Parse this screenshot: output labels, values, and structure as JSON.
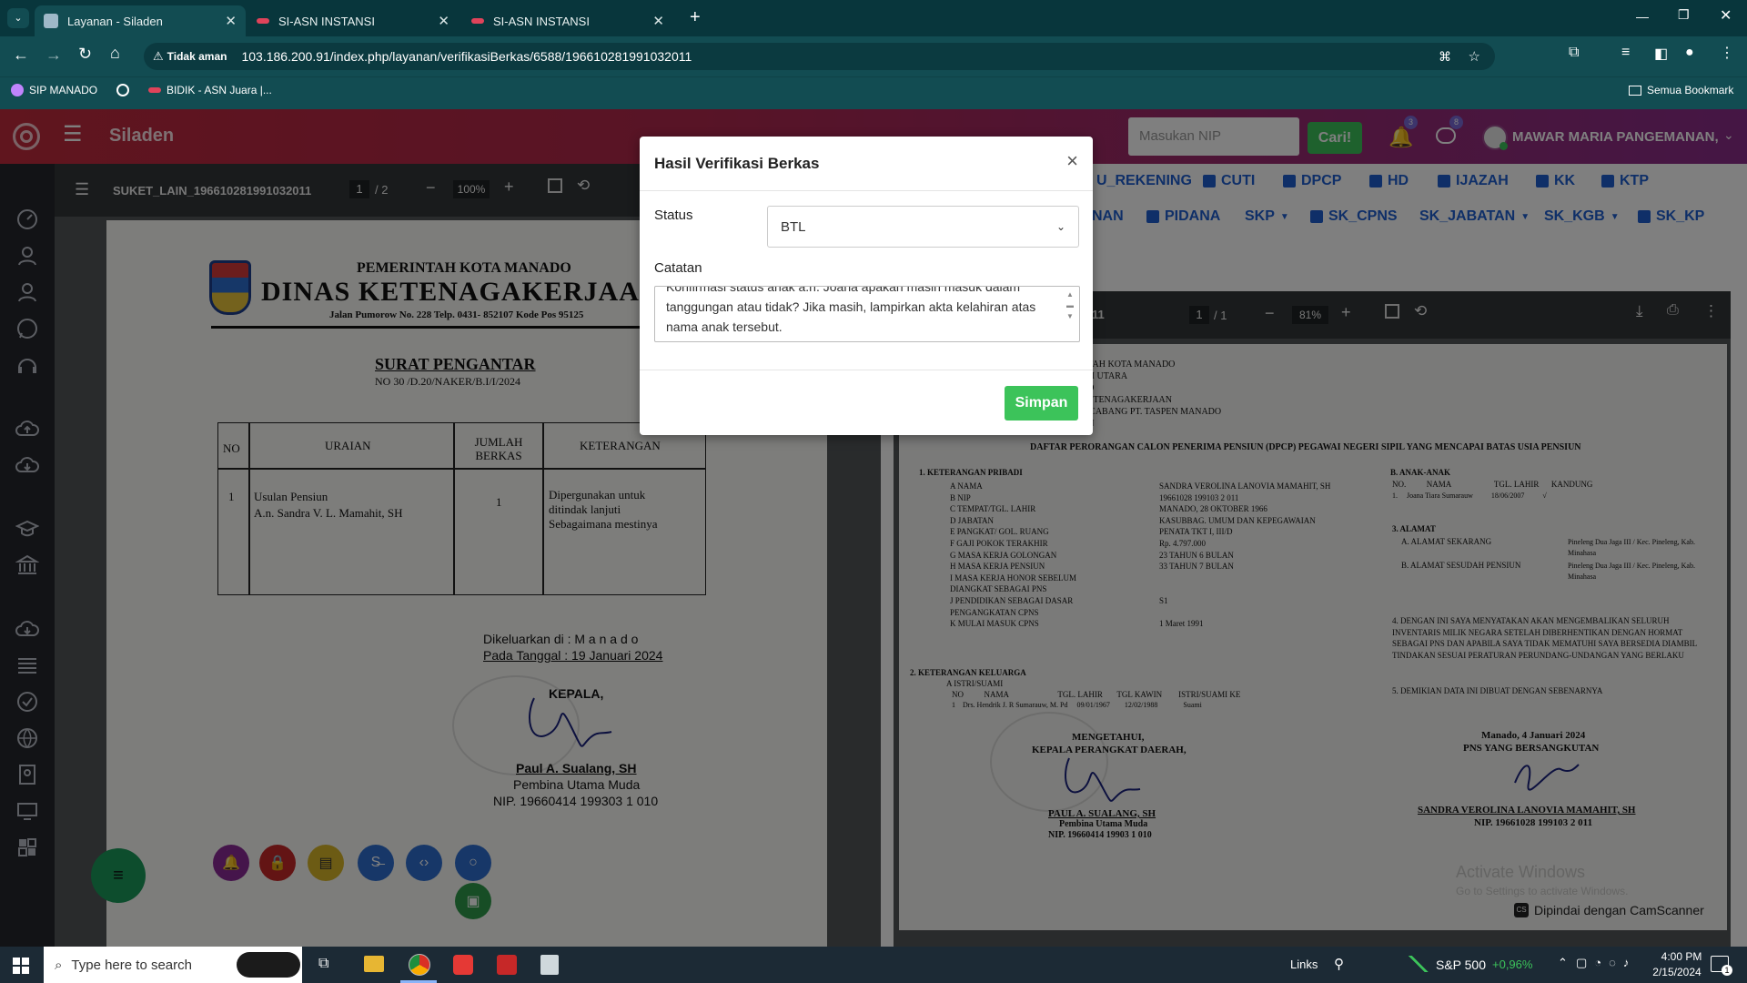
{
  "browser": {
    "tabs": [
      {
        "title": "Layanan - Siladen",
        "active": true
      },
      {
        "title": "SI-ASN INSTANSI",
        "active": false
      },
      {
        "title": "SI-ASN INSTANSI",
        "active": false
      }
    ],
    "security": "Tidak aman",
    "url": "103.186.200.91/index.php/layanan/verifikasiBerkas/6588/196610281991032011",
    "bookmarks": [
      "SIP MANADO",
      "BIDIK - ASN Juara |..."
    ],
    "all_bookmarks": "Semua Bookmark"
  },
  "app": {
    "name": "Siladen",
    "nip_placeholder": "Masukan NIP",
    "search_label": "Cari!",
    "notif_count": "3",
    "msg_count": "8",
    "user": "MAWAR MARIA PANGEMANAN,"
  },
  "left_viewer": {
    "filename": "SUKET_LAIN_196610281991032011",
    "page": "1",
    "total": "/ 2",
    "zoom": "100%"
  },
  "doc_tabs_row1": [
    "U_REKENING",
    "CUTI",
    "DPCP",
    "HD",
    "IJAZAH",
    "KK",
    "KTP"
  ],
  "doc_tabs_row2": [
    "NAN",
    "PIDANA",
    "SKP",
    "SK_CPNS",
    "SK_JABATAN",
    "SK_KGB",
    "SK_KP"
  ],
  "right_viewer": {
    "name_tail": "11",
    "page": "1",
    "total": "/ 1",
    "zoom": "81%"
  },
  "letter": {
    "gov": "PEMERINTAH KOTA MANADO",
    "dept": "DINAS KETENAGAKERJAA",
    "addr": "Jalan Pumorow No. 228 Telp. 0431- 852107 Kode Pos 95125",
    "title": "SURAT PENGANTAR",
    "number": "NO 30 /D.20/NAKER/B.I/I/2024",
    "col_no": "NO",
    "col_uraian": "URAIAN",
    "col_jumlah": "JUMLAH BERKAS",
    "col_ket": "KETERANGAN",
    "row_no": "1",
    "row_uraian_1": "Usulan Pensiun",
    "row_uraian_2": "A.n. Sandra V. L. Mamahit, SH",
    "row_jumlah": "1",
    "row_ket_1": "Dipergunakan untuk",
    "row_ket_2": "ditindak lanjuti",
    "row_ket_3": "Sebagaimana mestinya",
    "issued_at": "Dikeluarkan di  :  M a n a d o",
    "issued_on": "Pada Tanggal   :  19 Januari 2024",
    "kepala": "KEPALA,",
    "sig_name": "Paul A. Sualang, SH",
    "sig_rank": "Pembina Utama Muda",
    "sig_nip": "NIP. 19660414 199303 1 010"
  },
  "dpcp": {
    "head_lines": [
      "NTAH KOTA MANADO",
      "ESI UTARA",
      "DO",
      "KETENAGAKERJAAN",
      "R CABANG PT. TASPEN MANADO",
      "UN"
    ],
    "title": "DAFTAR PERORANGAN CALON PENERIMA PENSIUN (DPCP) PEGAWAI NEGERI SIPIL YANG MENCAPAI BATAS USIA PENSIUN",
    "sec1": "1.   KETERANGAN PRIBADI",
    "fields": [
      "A   NAMA",
      "B   NIP",
      "C   TEMPAT/TGL. LAHIR",
      "D   JABATAN",
      "E   PANGKAT/ GOL. RUANG",
      "F   GAJI POKOK TERAKHIR",
      "G   MASA KERJA GOLONGAN",
      "H   MASA KERJA PENSIUN",
      "I    MASA KERJA HONOR SEBELUM",
      "     DIANGKAT SEBAGAI PNS",
      "J    PENDIDIKAN SEBAGAI DASAR",
      "     PENGANGKATAN CPNS",
      "K   MULAI MASUK CPNS"
    ],
    "values": [
      "SANDRA VEROLINA LANOVIA MAMAHIT, SH",
      "19661028 199103 2 011",
      "MANADO, 28 OKTOBER 1966",
      "KASUBBAG. UMUM DAN KEPEGAWAIAN",
      "PENATA TKT I, III/D",
      "Rp. 4.797.000",
      "23 TAHUN 6 BULAN",
      "33 TAHUN 7 BULAN",
      "",
      "",
      "S1",
      "",
      "1 Maret 1991"
    ],
    "b_title": "B. ANAK-ANAK",
    "b_cols": "NO.          NAMA                     TGL. LAHIR      KANDUNG",
    "b_row": "1.     Joana Tiara Sumarauw          18/06/2007          √",
    "addr_title": "3. ALAMAT",
    "addr_a": "A. ALAMAT SEKARANG",
    "addr_a_val": "Pineleng Dua Jaga III / Kec. Pineleng, Kab. Minahasa",
    "addr_b": "B. ALAMAT SESUDAH PENSIUN",
    "addr_b_val": "Pineleng Dua Jaga III / Kec. Pineleng, Kab. Minahasa",
    "s4": "4. DENGAN INI SAYA MENYATAKAN AKAN MENGEMBALIKAN SELURUH INVENTARIS MILIK NEGARA SETELAH DIBERHENTIKAN DENGAN HORMAT SEBAGAI PNS DAN APABILA SAYA TIDAK MEMATUHI SAYA BERSEDIA DIAMBIL TINDAKAN SESUAI PERATURAN PERUNDANG-UNDANGAN YANG BERLAKU",
    "s5": "5. DEMIKIAN DATA INI DIBUAT DENGAN SEBENARNYA",
    "sec2": "2.   KETERANGAN KELUARGA",
    "spouse_title": "A   ISTRI/SUAMI",
    "spouse_cols": "NO          NAMA                        TGL. LAHIR       TGL KAWIN        ISTRI/SUAMI KE",
    "spouse_row": "1    Drs. Hendrik J. R Sumarauw, M. Pd     09/01/1967        12/02/1988              Suami",
    "mengetahui": "MENGETAHUI,",
    "kepala_pd": "KEPALA PERANGKAT DAERAH,",
    "left_sig": "PAUL  A.  SUALANG, SH",
    "left_rank": "Pembina Utama Muda",
    "left_nip": "NIP. 19660414 19903 1 010",
    "date": "Manado,  4 Januari 2024",
    "pns": "PNS  YANG BERSANGKUTAN",
    "right_sig": "SANDRA VEROLINA LANOVIA MAMAHIT, SH",
    "right_nip": "NIP. 19661028 199103 2 011",
    "scanner": "Dipindai dengan CamScanner",
    "watermark1": "Activate Windows",
    "watermark2": "Go to Settings to activate Windows."
  },
  "modal": {
    "title": "Hasil Verifikasi Berkas",
    "status_label": "Status",
    "status_value": "BTL",
    "note_label": "Catatan",
    "note_value": "Konfirmasi status anak a.n. Joana apakah masih masuk dalam tanggungan atau tidak? Jika masih, lampirkan akta kelahiran atas nama anak tersebut.",
    "save_label": "Simpan"
  },
  "taskbar": {
    "search_placeholder": "Type here to search",
    "links": "Links",
    "stock_name": "S&P 500",
    "stock_change": "+0,96%",
    "time": "4:00 PM",
    "date": "2/15/2024",
    "notif": "1"
  },
  "colors": {
    "accent_green": "#3cc35a",
    "header_start": "#c02a3c",
    "header_end": "#8a2d8a",
    "link_blue": "#1f5fd0"
  }
}
